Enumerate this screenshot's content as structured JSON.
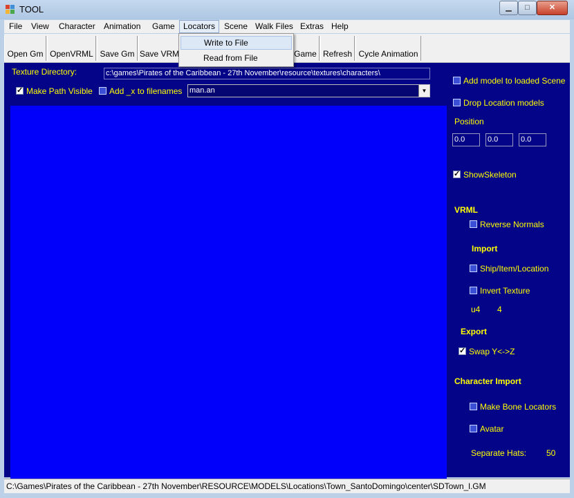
{
  "window": {
    "title": "TOOL",
    "minimize_label": "▁",
    "maximize_label": "□",
    "close_label": "✕"
  },
  "menu": {
    "items": [
      "File",
      "View",
      "Character",
      "Animation",
      "Game",
      "Locators",
      "Scene",
      "Walk Files",
      "Extras",
      "Help"
    ],
    "open": "Locators",
    "dropdown": [
      "Write to File",
      "Read from File"
    ]
  },
  "toolbar": {
    "buttons": [
      "Open Gm",
      "OpenVRML",
      "Save Gm",
      "Save VRM",
      "Game",
      "Refresh",
      "Cycle Animation"
    ]
  },
  "top": {
    "texture_dir_label": "Texture Directory:",
    "texture_dir_value": "c:\\games\\Pirates of the Caribbean - 27th November\\resource\\textures\\characters\\",
    "make_path_visible": "Make Path Visible",
    "add_x": "Add _x to filenames",
    "animation_file": "man.an"
  },
  "right": {
    "add_model": "Add model to loaded Scene",
    "drop_location": "Drop Location models",
    "position_label": "Position",
    "position": [
      "0.0",
      "0.0",
      "0.0"
    ],
    "show_skeleton": "ShowSkeleton",
    "vrml_heading": "VRML",
    "reverse_normals": "Reverse Normals",
    "import_heading": "Import",
    "ship_item_location": "Ship/Item/Location",
    "invert_texture": "Invert Texture",
    "u4_label": "u4",
    "u4_value": "4",
    "export_heading": "Export",
    "swap_label": "Swap  Y<->Z",
    "char_import_heading": "Character Import",
    "make_bone_locators": "Make Bone Locators",
    "avatar": "Avatar",
    "separate_hats_label": "Separate Hats:",
    "separate_hats_value": "50"
  },
  "status": {
    "path": "C:\\Games\\Pirates of the Caribbean - 27th November\\RESOURCE\\MODELS\\Locations\\Town_SantoDomingo\\center\\SDTown_l.GM"
  }
}
